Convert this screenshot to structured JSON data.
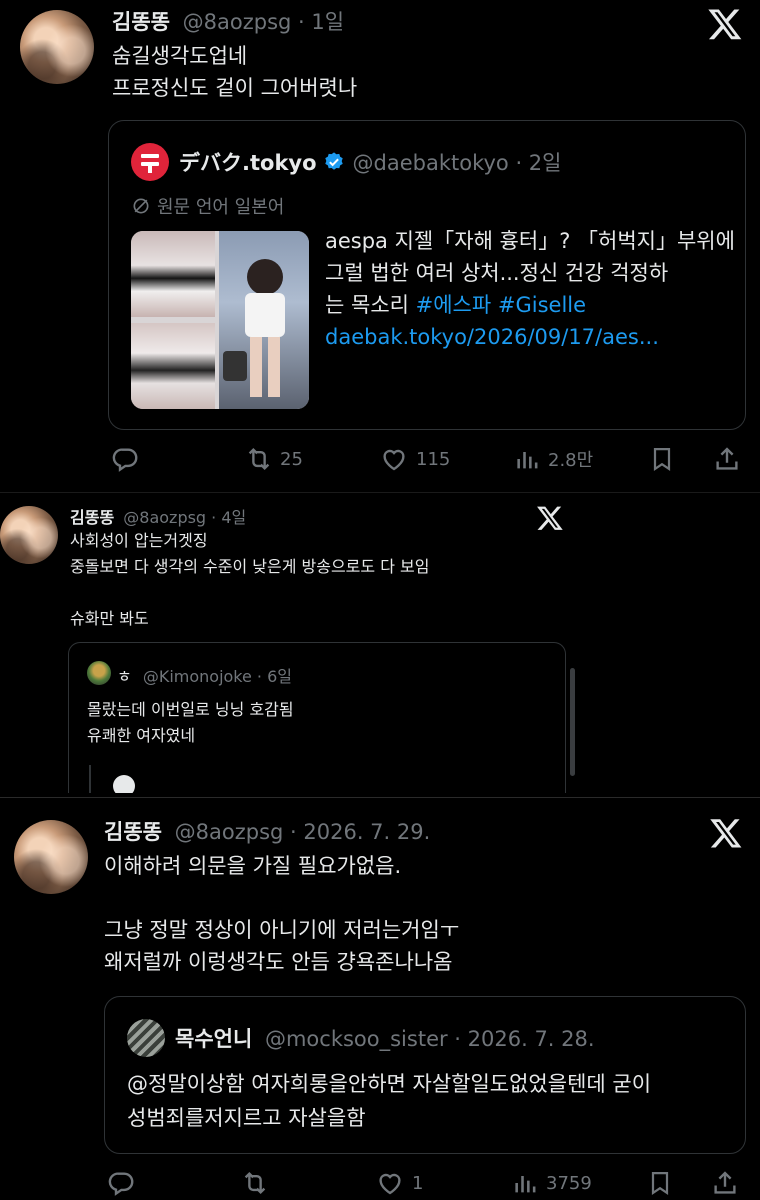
{
  "post1": {
    "author": "김똥똥",
    "handle": "@8aozpsg · 1일",
    "line1": "숨길생각도업네",
    "line2": "프로정신도 겉이 그어버렷나",
    "quote": {
      "source_name": "デバク.tokyo",
      "handle": "@daebaktokyo · 2일",
      "translate_note": "원문 언어 일본어",
      "text1": "aespa 지젤「자해 흉터」? 「허벅지」부위에",
      "text2": "그럴 법한 여러 상처...정신 건강 걱정하",
      "text3_prefix": "는 목소리 ",
      "hashtag1": "#에스파",
      "hashtag2": "#Giselle",
      "url": "daebak.tokyo/2026/09/17/aes..."
    },
    "actions": {
      "retweets": "25",
      "likes": "115",
      "views": "2.8만"
    }
  },
  "post2": {
    "author": "김똥똥",
    "handle": "@8aozpsg · 4일",
    "line1": "사회성이 압는거겟징",
    "line2": "중돌보면 다 생각의 수준이 낮은게 방송으로도 다 보임",
    "line3": "슈화만 봐도",
    "quote": {
      "name": "ㅎ",
      "handle": "@Kimonojoke · 6일",
      "line1": "몰랐는데 이번일로 닝닝 호감됨",
      "line2": "유쾌한 여자였네"
    }
  },
  "post3": {
    "author": "김똥똥",
    "handle": "@8aozpsg · 2026. 7. 29.",
    "line1": "이해하려 의문을 가질 필요가없음.",
    "line2": "그냥 정말 정상이 아니기에 저러는거임ㅜ",
    "line3": "왜저럴까 이렁생각도 안듬 걍욕존나나옴",
    "quote": {
      "name": "목수언니",
      "handle": "@mocksoo_sister · 2026. 7. 28.",
      "line1": "@정말이상함 여자희롱을안하면 자살할일도없었을텐데 굳이",
      "line2": "성범죄를저지르고 자살을함"
    },
    "actions": {
      "likes": "1",
      "views": "3759"
    }
  },
  "colors": {
    "background": "#000000",
    "text": "#e7e9ea",
    "muted": "#71767b",
    "link": "#1d9bf0",
    "verified": "#1d9bf0",
    "brand_red": "#e0243a"
  },
  "icons": [
    "x-logo-icon",
    "reply-icon",
    "retweet-icon",
    "like-icon",
    "views-icon",
    "bookmark-icon",
    "share-icon",
    "verified-icon",
    "translate-icon"
  ]
}
